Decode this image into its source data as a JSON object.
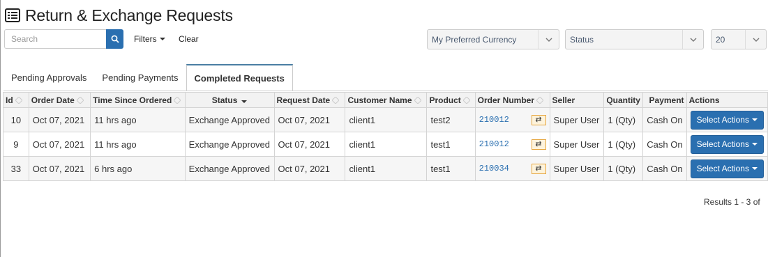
{
  "page": {
    "title": "Return & Exchange Requests",
    "title_icon": "list-icon"
  },
  "toolbar": {
    "search_placeholder": "Search",
    "filters_label": "Filters",
    "clear_label": "Clear",
    "currency_select": "My Preferred Currency",
    "status_select": "Status",
    "page_size_select": "20"
  },
  "tabs": [
    {
      "label": "Pending Approvals",
      "active": false
    },
    {
      "label": "Pending Payments",
      "active": false
    },
    {
      "label": "Completed Requests",
      "active": true
    }
  ],
  "table": {
    "columns": [
      "Id",
      "Order Date",
      "Time Since Ordered",
      "Status",
      "Request Date",
      "Customer Name",
      "Product",
      "Order Number",
      "Seller",
      "Quantity",
      "Payment",
      "Actions"
    ],
    "rows": [
      {
        "id": "10",
        "order_date": "Oct 07, 2021",
        "time_since": "11 hrs ago",
        "status": "Exchange Approved",
        "request_date": "Oct 07, 2021",
        "customer": "client1",
        "product": "test2",
        "order_number": "210012",
        "seller": "Super User",
        "quantity": "1 (Qty)",
        "payment": "Cash On",
        "action": "Select Actions"
      },
      {
        "id": "9",
        "order_date": "Oct 07, 2021",
        "time_since": "11 hrs ago",
        "status": "Exchange Approved",
        "request_date": "Oct 07, 2021",
        "customer": "client1",
        "product": "test1",
        "order_number": "210012",
        "seller": "Super User",
        "quantity": "1 (Qty)",
        "payment": "Cash On",
        "action": "Select Actions"
      },
      {
        "id": "33",
        "order_date": "Oct 07, 2021",
        "time_since": "6 hrs ago",
        "status": "Exchange Approved",
        "request_date": "Oct 07, 2021",
        "customer": "client1",
        "product": "test1",
        "order_number": "210034",
        "seller": "Super User",
        "quantity": "1 (Qty)",
        "payment": "Cash On",
        "action": "Select Actions"
      }
    ]
  },
  "footer": {
    "results": "Results 1 - 3 of"
  },
  "colors": {
    "primary": "#2a6fb0",
    "tab_accent": "#4a7ea3",
    "swap_border": "#e6a53c"
  }
}
